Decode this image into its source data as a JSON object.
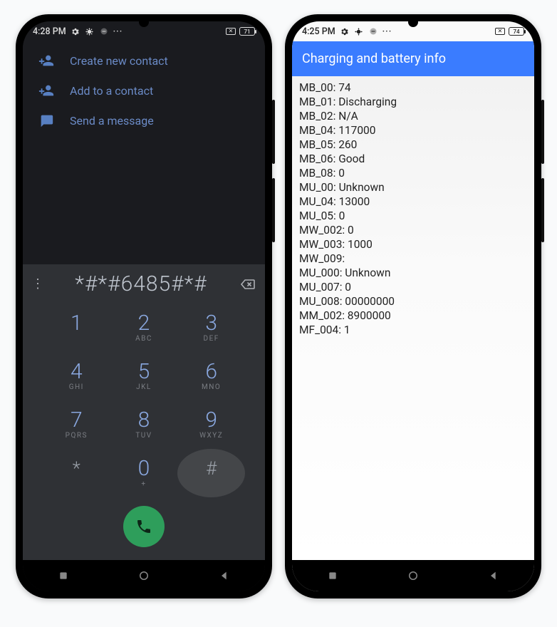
{
  "left": {
    "status": {
      "time": "4:28 PM",
      "battery": "71"
    },
    "actions": [
      {
        "icon": "person-add-icon",
        "label": "Create new contact"
      },
      {
        "icon": "person-add-icon",
        "label": "Add to a contact"
      },
      {
        "icon": "message-icon",
        "label": "Send a message"
      }
    ],
    "entered": "*#*#6485#*#",
    "keys": [
      {
        "d": "1",
        "s": ""
      },
      {
        "d": "2",
        "s": "ABC"
      },
      {
        "d": "3",
        "s": "DEF"
      },
      {
        "d": "4",
        "s": "GHI"
      },
      {
        "d": "5",
        "s": "JKL"
      },
      {
        "d": "6",
        "s": "MNO"
      },
      {
        "d": "7",
        "s": "PQRS"
      },
      {
        "d": "8",
        "s": "TUV"
      },
      {
        "d": "9",
        "s": "WXYZ"
      },
      {
        "d": "*",
        "s": "",
        "sym": true
      },
      {
        "d": "0",
        "s": "+"
      },
      {
        "d": "#",
        "s": "",
        "sym": true,
        "hl": true
      }
    ]
  },
  "right": {
    "status": {
      "time": "4:25 PM",
      "battery": "74"
    },
    "title": "Charging and battery info",
    "items": [
      {
        "k": "MB_00",
        "v": "74"
      },
      {
        "k": "MB_01",
        "v": "Discharging"
      },
      {
        "k": "MB_02",
        "v": "N/A"
      },
      {
        "k": "MB_04",
        "v": "117000"
      },
      {
        "k": "MB_05",
        "v": "260"
      },
      {
        "k": "MB_06",
        "v": "Good"
      },
      {
        "k": "MB_08",
        "v": "0"
      },
      {
        "k": "MU_00",
        "v": "Unknown"
      },
      {
        "k": "MU_04",
        "v": "13000"
      },
      {
        "k": "MU_05",
        "v": "0"
      },
      {
        "k": "MW_002",
        "v": "0"
      },
      {
        "k": "MW_003",
        "v": "1000"
      },
      {
        "k": "MW_009",
        "v": ""
      },
      {
        "k": "MU_000",
        "v": "Unknown"
      },
      {
        "k": "MU_007",
        "v": "0"
      },
      {
        "k": "MU_008",
        "v": "00000000"
      },
      {
        "k": "MM_002",
        "v": "8900000"
      },
      {
        "k": "MF_004",
        "v": "1"
      }
    ]
  }
}
